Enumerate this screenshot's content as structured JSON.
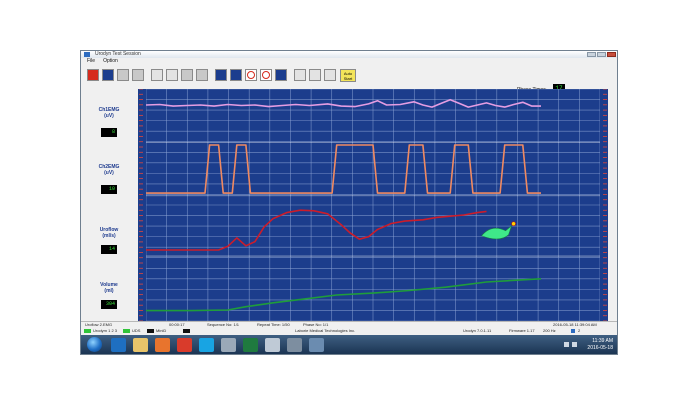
{
  "window": {
    "title": "Urodyn Test Session"
  },
  "menu": {
    "items": [
      "File",
      "Option"
    ]
  },
  "toolbar": {
    "autostart_label_1": "Auto",
    "autostart_label_2": "Start",
    "phase_timer_label": "Phase Timer:",
    "phase_timer_value": "17"
  },
  "channels": [
    {
      "name": "Ch1EMG",
      "unit": "(uV)",
      "value": "8",
      "color": "#e59de2"
    },
    {
      "name": "Ch2EMG",
      "unit": "(uV)",
      "value": "10",
      "color": "#f08a61"
    },
    {
      "name": "Uroflow",
      "unit": "(ml/s)",
      "value": "14",
      "color": "#cc1c2a"
    },
    {
      "name": "Volume",
      "unit": "(ml)",
      "value": "304",
      "color": "#1f9d3a"
    }
  ],
  "chart_data": {
    "type": "line",
    "x": {
      "range": [
        0,
        100
      ],
      "note": "time in percent of visible sweep"
    },
    "grid": true,
    "background": "#1c3d8c",
    "gridline_color": "#8fa6d6",
    "series": [
      {
        "name": "Ch1EMG",
        "color": "#e59de2",
        "band": [
          0,
          0.23
        ],
        "points": [
          [
            0,
            0.3
          ],
          [
            3,
            0.29
          ],
          [
            6,
            0.32
          ],
          [
            9,
            0.31
          ],
          [
            12,
            0.3
          ],
          [
            15,
            0.32
          ],
          [
            18,
            0.29
          ],
          [
            21,
            0.31
          ],
          [
            24,
            0.3
          ],
          [
            27,
            0.33
          ],
          [
            30,
            0.31
          ],
          [
            33,
            0.29
          ],
          [
            36,
            0.31
          ],
          [
            40,
            0.28
          ],
          [
            43,
            0.32
          ],
          [
            46,
            0.33
          ],
          [
            49,
            0.28
          ],
          [
            51,
            0.22
          ],
          [
            53,
            0.3
          ],
          [
            56,
            0.29
          ],
          [
            59,
            0.24
          ],
          [
            61,
            0.3
          ],
          [
            63,
            0.34
          ],
          [
            65,
            0.27
          ],
          [
            67,
            0.2
          ],
          [
            69,
            0.27
          ],
          [
            71,
            0.34
          ],
          [
            73,
            0.3
          ],
          [
            75,
            0.26
          ],
          [
            77,
            0.31
          ],
          [
            79,
            0.34
          ],
          [
            81,
            0.29
          ],
          [
            83,
            0.25
          ],
          [
            85,
            0.32
          ],
          [
            87,
            0.32
          ]
        ]
      },
      {
        "name": "Ch2EMG",
        "color": "#f08a61",
        "band": [
          0.23,
          0.46
        ],
        "points": [
          [
            0,
            0.95
          ],
          [
            13,
            0.95
          ],
          [
            14,
            0.05
          ],
          [
            16,
            0.05
          ],
          [
            17,
            0.95
          ],
          [
            19,
            0.95
          ],
          [
            20,
            0.05
          ],
          [
            22,
            0.05
          ],
          [
            23,
            0.95
          ],
          [
            41,
            0.95
          ],
          [
            42,
            0.05
          ],
          [
            50,
            0.05
          ],
          [
            51,
            0.95
          ],
          [
            57,
            0.95
          ],
          [
            58,
            0.05
          ],
          [
            61,
            0.05
          ],
          [
            62,
            0.95
          ],
          [
            67,
            0.95
          ],
          [
            68,
            0.05
          ],
          [
            71,
            0.05
          ],
          [
            72,
            0.95
          ],
          [
            78,
            0.95
          ],
          [
            79,
            0.05
          ],
          [
            83,
            0.05
          ],
          [
            84,
            0.95
          ],
          [
            87,
            0.95
          ]
        ]
      },
      {
        "name": "Uroflow",
        "color": "#cc1c2a",
        "band": [
          0.46,
          0.72
        ],
        "points": [
          [
            0,
            0.9
          ],
          [
            8,
            0.9
          ],
          [
            16,
            0.9
          ],
          [
            18,
            0.84
          ],
          [
            20,
            0.7
          ],
          [
            22,
            0.83
          ],
          [
            24,
            0.76
          ],
          [
            26,
            0.52
          ],
          [
            28,
            0.38
          ],
          [
            31,
            0.28
          ],
          [
            34,
            0.24
          ],
          [
            37,
            0.25
          ],
          [
            40,
            0.3
          ],
          [
            43,
            0.48
          ],
          [
            45,
            0.62
          ],
          [
            47,
            0.72
          ],
          [
            49,
            0.68
          ],
          [
            51,
            0.56
          ],
          [
            54,
            0.46
          ],
          [
            57,
            0.42
          ],
          [
            61,
            0.4
          ],
          [
            64,
            0.36
          ],
          [
            67,
            0.34
          ],
          [
            70,
            0.32
          ],
          [
            73,
            0.28
          ],
          [
            75,
            0.26
          ]
        ]
      },
      {
        "name": "Volume",
        "color": "#1f9d3a",
        "band": [
          0.72,
          1.0
        ],
        "points": [
          [
            0,
            0.84
          ],
          [
            10,
            0.84
          ],
          [
            18,
            0.83
          ],
          [
            22,
            0.78
          ],
          [
            28,
            0.72
          ],
          [
            35,
            0.66
          ],
          [
            42,
            0.6
          ],
          [
            50,
            0.57
          ],
          [
            58,
            0.53
          ],
          [
            66,
            0.48
          ],
          [
            75,
            0.4
          ],
          [
            82,
            0.37
          ],
          [
            87,
            0.35
          ]
        ]
      }
    ],
    "marker": {
      "name": "uroflow-marker",
      "at": [
        77,
        0.63
      ],
      "color": "#3fe889"
    }
  },
  "status": {
    "file": "Uroflow 2.EMG",
    "time": "00:00:17",
    "sequence": "Sequence No: 1/1",
    "repeat": "Repeat Time: 1/50",
    "phase": "Phase No: 1/1",
    "datetime": "2016-05-18 11:39:04 AM"
  },
  "devices": {
    "urodyn": "Urodym 1 2 3",
    "uds": "UDS",
    "mode": "MiniD",
    "company": "Laborie Medical Technologies Inc.",
    "version": "Urodyn 7.0.1.11",
    "firmware": "Firmware 1.17",
    "rate": "200 Hz",
    "count": "2"
  },
  "tray": {
    "time": "11:39 AM",
    "date": "2016-05-18"
  }
}
